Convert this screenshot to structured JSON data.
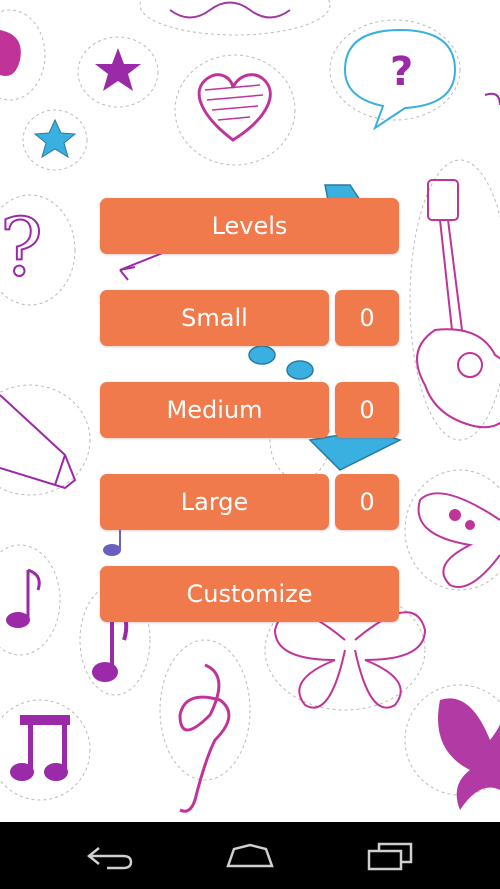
{
  "menu": {
    "levels_label": "Levels",
    "small_label": "Small",
    "small_count": "0",
    "medium_label": "Medium",
    "medium_count": "0",
    "large_label": "Large",
    "large_count": "0",
    "customize_label": "Customize"
  },
  "colors": {
    "button": "#f07a4b",
    "button_text": "#ffffff",
    "navbar": "#000000",
    "sticker_purple": "#9b2aa8",
    "sticker_magenta": "#c0349a",
    "sticker_blue": "#3ab0e0"
  },
  "navbar": {
    "icons": [
      "back-icon",
      "home-icon",
      "recent-apps-icon"
    ]
  }
}
